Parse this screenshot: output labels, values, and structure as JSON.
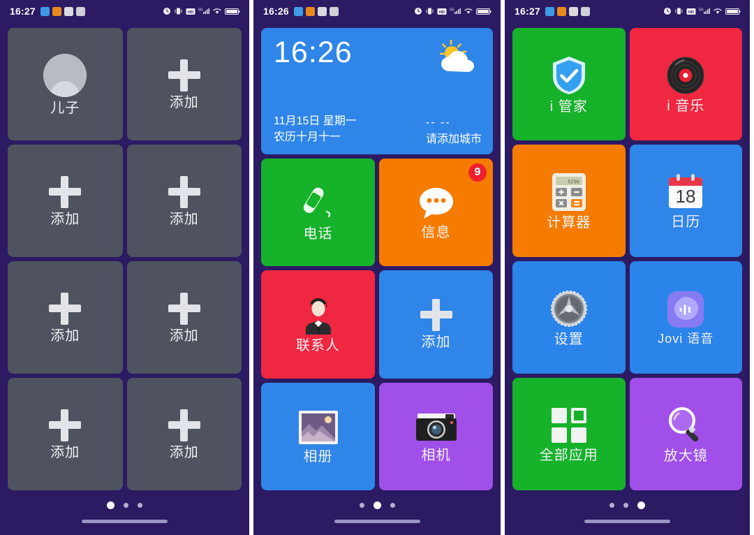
{
  "colors": {
    "background": "#2c1a63",
    "tile_grey": "#4e535f",
    "green": "#15b22a",
    "orange": "#f57c00",
    "red": "#f02741",
    "red_contacts": "#ef2436",
    "blue": "#2f86e8",
    "blue_settings": "#2b84ea",
    "purple": "#a050e8",
    "badge_red": "#f01f2e",
    "widget_blue": "#2f86e8"
  },
  "screens": [
    {
      "name": "contacts-page",
      "statusbar": {
        "time": "16:27",
        "left_icons": [
          "notification-icon-blue",
          "notification-icon-orange",
          "notification-icon-white",
          "notification-icon-grey"
        ],
        "right_icons": [
          "alarm-icon",
          "vibrate-icon",
          "hd-icon",
          "signal-5g-icon",
          "wifi-icon",
          "battery-icon"
        ]
      },
      "tiles": [
        [
          {
            "label": "儿子",
            "icon": "contact-avatar-icon",
            "style": "grey"
          },
          {
            "label": "添加",
            "icon": "plus-icon",
            "style": "grey"
          }
        ],
        [
          {
            "label": "添加",
            "icon": "plus-icon",
            "style": "grey"
          },
          {
            "label": "添加",
            "icon": "plus-icon",
            "style": "grey"
          }
        ],
        [
          {
            "label": "添加",
            "icon": "plus-icon",
            "style": "grey"
          },
          {
            "label": "添加",
            "icon": "plus-icon",
            "style": "grey"
          }
        ],
        [
          {
            "label": "添加",
            "icon": "plus-icon",
            "style": "grey"
          },
          {
            "label": "添加",
            "icon": "plus-icon",
            "style": "grey"
          }
        ]
      ],
      "page_dots": {
        "count": 3,
        "active": 0
      }
    },
    {
      "name": "home-page",
      "statusbar": {
        "time": "16:26",
        "left_icons": [
          "notification-icon-blue",
          "notification-icon-orange",
          "notification-icon-white",
          "notification-icon-grey"
        ],
        "right_icons": [
          "alarm-icon",
          "vibrate-icon",
          "hd-icon",
          "signal-5g-icon",
          "wifi-icon",
          "battery-icon"
        ]
      },
      "widget": {
        "time": "16:26",
        "date": "11月15日  星期一",
        "lunar": "农历十月十一",
        "temperature": "--  --",
        "city_hint": "请添加城市",
        "weather_icon": "sun-cloud-icon"
      },
      "tiles": [
        [
          {
            "label": "电话",
            "icon": "phone-handset-icon",
            "style": "green"
          },
          {
            "label": "信息",
            "icon": "message-bubble-icon",
            "style": "orange",
            "badge": "9"
          }
        ],
        [
          {
            "label": "联系人",
            "icon": "person-suit-icon",
            "style": "red"
          },
          {
            "label": "添加",
            "icon": "plus-icon",
            "style": "blue"
          }
        ],
        [
          {
            "label": "相册",
            "icon": "photo-frame-icon",
            "style": "blue"
          },
          {
            "label": "相机",
            "icon": "camera-icon",
            "style": "purple"
          }
        ]
      ],
      "page_dots": {
        "count": 3,
        "active": 1
      }
    },
    {
      "name": "apps-page",
      "statusbar": {
        "time": "16:27",
        "left_icons": [
          "notification-icon-blue",
          "notification-icon-orange",
          "notification-icon-white",
          "notification-icon-grey"
        ],
        "right_icons": [
          "alarm-icon",
          "vibrate-icon",
          "hd-icon",
          "signal-5g-icon",
          "wifi-icon",
          "battery-icon"
        ]
      },
      "tiles": [
        [
          {
            "label": "i 管家",
            "icon": "shield-check-icon",
            "style": "green"
          },
          {
            "label": "i 音乐",
            "icon": "vinyl-record-icon",
            "style": "red"
          }
        ],
        [
          {
            "label": "计算器",
            "icon": "calculator-icon",
            "style": "orange"
          },
          {
            "label": "日历",
            "icon": "calendar-icon",
            "style": "blue",
            "icon_text": "18"
          }
        ],
        [
          {
            "label": "设置",
            "icon": "gear-icon",
            "style": "blue"
          },
          {
            "label": "Jovi 语音",
            "icon": "jovi-voice-icon",
            "style": "blue"
          }
        ],
        [
          {
            "label": "全部应用",
            "icon": "grid-apps-icon",
            "style": "green"
          },
          {
            "label": "放大镜",
            "icon": "magnifier-icon",
            "style": "purple"
          }
        ]
      ],
      "page_dots": {
        "count": 3,
        "active": 2
      }
    }
  ]
}
